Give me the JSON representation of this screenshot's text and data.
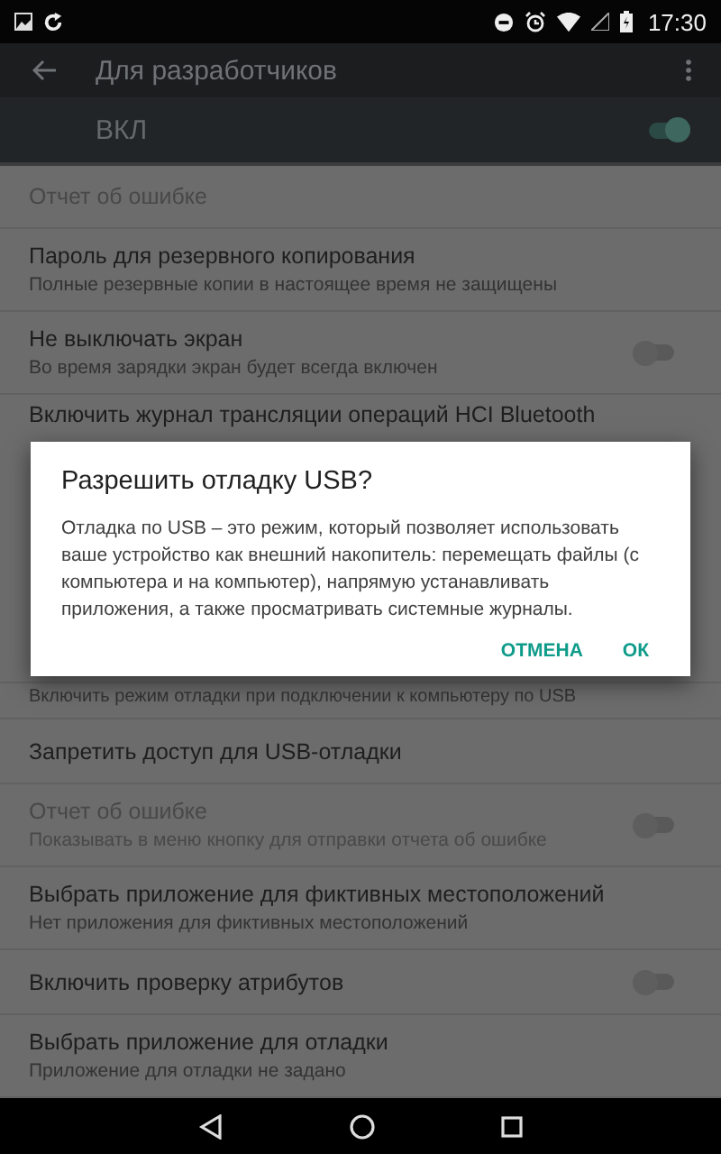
{
  "status_bar": {
    "time": "17:30"
  },
  "toolbar": {
    "title": "Для разработчиков"
  },
  "master_switch": {
    "label": "ВКЛ",
    "on": true
  },
  "items": [
    {
      "kind": "plain",
      "title": "Отчет об ошибке",
      "disabled": true
    },
    {
      "kind": "plain",
      "title": "Пароль для резервного копирования",
      "summary": "Полные резервные копии в настоящее время не защищены",
      "disabled": false
    },
    {
      "kind": "toggle",
      "title": "Не выключать экран",
      "summary": "Во время зарядки экран будет всегда включен",
      "disabled": false,
      "on": false
    },
    {
      "kind": "covered",
      "title": "Включить журнал трансляции операций HCI Bluetooth",
      "disabled": false
    },
    {
      "kind": "summary_only",
      "summary": "Включить режим отладки при подключении к компьютеру по USB",
      "disabled": false
    },
    {
      "kind": "plain",
      "title": "Запретить доступ для USB-отладки",
      "disabled": false
    },
    {
      "kind": "toggle",
      "title": "Отчет об ошибке",
      "summary": "Показывать в меню кнопку для отправки отчета об ошибке",
      "disabled": true,
      "on": false
    },
    {
      "kind": "plain",
      "title": "Выбрать приложение для фиктивных местоположений",
      "summary": "Нет приложения для фиктивных местоположений",
      "disabled": false
    },
    {
      "kind": "toggle",
      "title": "Включить проверку атрибутов",
      "disabled": false,
      "on": false
    },
    {
      "kind": "plain",
      "title": "Выбрать приложение для отладки",
      "summary": "Приложение для отладки не задано",
      "disabled": false
    }
  ],
  "dialog": {
    "title": "Разрешить отладку USB?",
    "message": "Отладка по USB – это режим, который позволяет использовать ваше устройство как внешний накопитель: перемещать файлы (с компьютера и на компьютер), напрямую устанавливать приложения, а также просматривать системные журналы.",
    "buttons": [
      "ОТМЕНА",
      "ОК"
    ]
  }
}
